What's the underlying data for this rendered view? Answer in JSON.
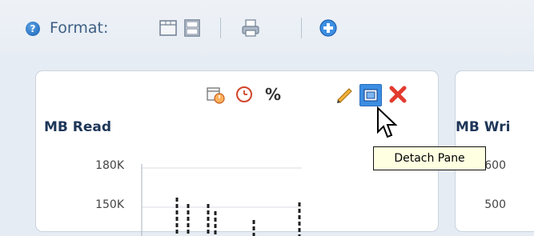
{
  "toolbar": {
    "help_glyph": "?",
    "format_label": "Format:",
    "icons": [
      "layout-grid-icon",
      "layout-stack-icon",
      "print-icon",
      "add-icon"
    ]
  },
  "panel1": {
    "title": "MB Read",
    "tools": [
      "schedule-calendar-icon",
      "clock-icon",
      "percent-icon",
      "edit-pencil-icon",
      "detach-pane-icon",
      "close-icon"
    ],
    "percent_glyph": "%",
    "y_ticks": [
      "180K",
      "150K"
    ]
  },
  "panel2": {
    "title": "MB Wri",
    "y_ticks": [
      "600",
      "500"
    ]
  },
  "tooltip": {
    "text": "Detach Pane"
  },
  "colors": {
    "accent": "#3c8ee2",
    "close": "#e23b2e",
    "title": "#1e3658"
  }
}
